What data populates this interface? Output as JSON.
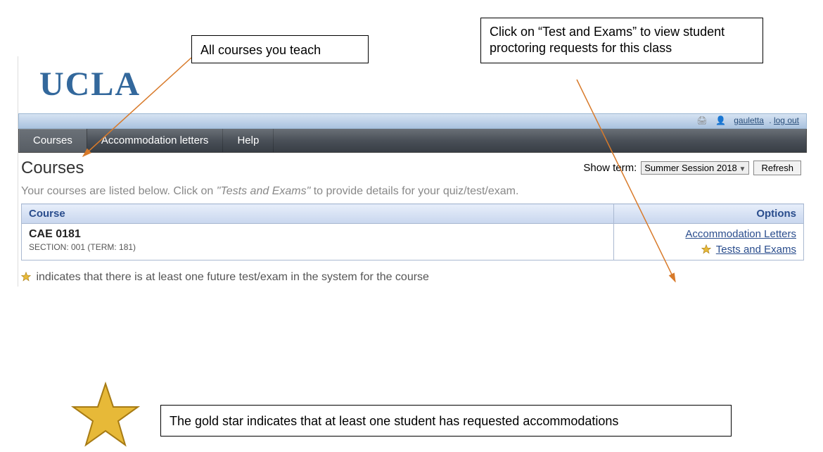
{
  "annotations": {
    "all_courses": "All courses you teach",
    "tests_exams_click": "Click on “Test and Exams” to view student proctoring requests for this class",
    "gold_star_note": "The gold star indicates that at least one student has requested accommodations"
  },
  "brand": "UCLA",
  "userstrip": {
    "username": "gauletta",
    "logout": "log out"
  },
  "nav": {
    "courses": "Courses",
    "accom_letters": "Accommodation letters",
    "help": "Help"
  },
  "page": {
    "title": "Courses",
    "show_term_label": "Show term:",
    "term_value": "Summer Session 2018",
    "refresh": "Refresh",
    "hint_pre": "Your courses are listed below. Click on ",
    "hint_em": "\"Tests and Exams\"",
    "hint_post": " to provide details for your quiz/test/exam."
  },
  "table": {
    "header_course": "Course",
    "header_options": "Options",
    "course_code": "CAE 0181",
    "section_line": "SECTION: 001 (TERM: 181)",
    "link_accom": "Accommodation Letters",
    "link_tests": "Tests and Exams"
  },
  "legend": {
    "text": " indicates that there is at least one future test/exam in the system for the course"
  }
}
